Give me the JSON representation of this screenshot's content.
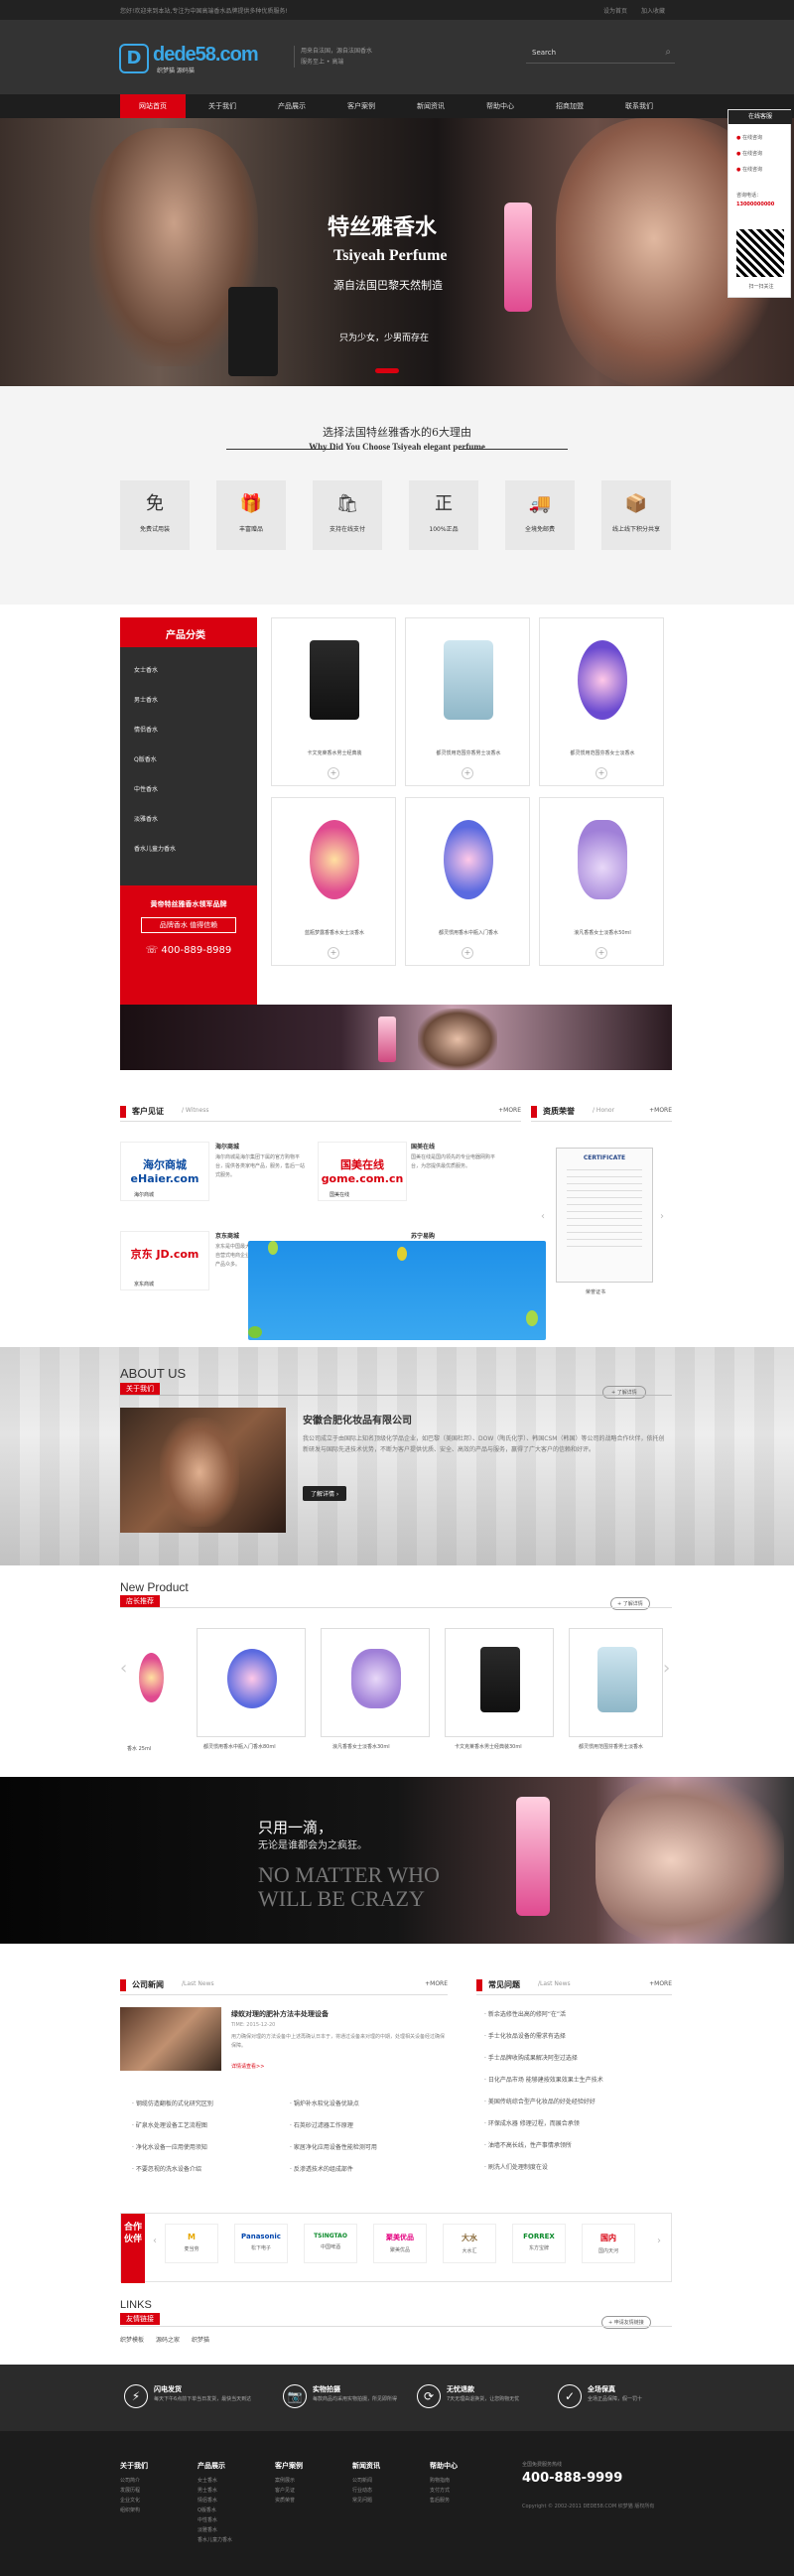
{
  "topbar": {
    "welcome": "您好!欢迎来到本站,专注为中国高端香水品牌提供多种优质服务!",
    "links": [
      "设为首页",
      "加入收藏"
    ]
  },
  "header": {
    "logo_mark": "D",
    "logo_text": "dede58.com",
    "logo_sub": "织梦猫 源码猫",
    "slogan": [
      "用来自法国，源自法国香水",
      "服务至上 • 高端"
    ],
    "search_placeholder": "Search"
  },
  "nav": [
    "网站首页",
    "关于我们",
    "产品展示",
    "客户案例",
    "新闻资讯",
    "帮助中心",
    "招商加盟",
    "联系我们"
  ],
  "hero": {
    "title": "特丝雅香水",
    "title_en": "Tsiyeah Perfume",
    "subtitle": "源自法国巴黎天然制造",
    "tagline": "只为少女，少男而存在"
  },
  "float_panel": {
    "title": "在线客服",
    "items": [
      "在线咨询",
      "在线咨询",
      "在线咨询"
    ],
    "phone_label": "咨询电话：",
    "phone": "13000000000",
    "qr_label": "扫一扫关注"
  },
  "why": {
    "title": "选择法国特丝雅香水的6大理由",
    "subtitle": "Why Did You Choose Tsiyeah elegant perfume",
    "items": [
      {
        "icon": "免",
        "label": "免费试用装"
      },
      {
        "icon": "🎁",
        "label": "丰富赠品"
      },
      {
        "icon": "🛍",
        "label": "支持在线支付"
      },
      {
        "icon": "正",
        "label": "100%正品"
      },
      {
        "icon": "🚚",
        "label": "全境免邮费"
      },
      {
        "icon": "📦",
        "label": "线上线下积分共享"
      }
    ]
  },
  "categories": {
    "title": "产品分类",
    "items": [
      "女士香水",
      "男士香水",
      "情侣香水",
      "Q版香水",
      "中性香水",
      "淡雅香水",
      "香水儿童力香水"
    ],
    "promo": "黄帝特丝雅香水领军品牌",
    "promo_button": "品牌香水 值得信赖",
    "phone": "400-889-8989"
  },
  "products": [
    {
      "name": "卡文克莱香水男士经典装"
    },
    {
      "name": "都灵惯用范围芬香男士淡香水"
    },
    {
      "name": "都灵惯用范围芬香女士淡香水"
    },
    {
      "name": "蓝瓶梦露香香水女士淡香水"
    },
    {
      "name": "都灵惯用香水中瓶入门香水"
    },
    {
      "name": "浪凡香香女士淡香水50ml"
    }
  ],
  "witness": {
    "title": "客户见证",
    "sub": "/ Witness",
    "more": "+MORE",
    "items": [
      {
        "logo": "海尔商城 eHaier.com",
        "name": "海尔商城",
        "caption": "海尔商城",
        "desc": "海尔商城是海尔集团下属的官方购物平台，提供各类家电产品，服务，售后一站式服务。"
      },
      {
        "logo": "国美在线 gome.com.cn",
        "name": "国美在线",
        "caption": "国美在线",
        "desc": "国美在线是国内领先的专业电器网购平台，为您提供最优质服务。"
      },
      {
        "logo": "京东 JD.com",
        "name": "京东商城",
        "caption": "京东商城",
        "desc": "京东是中国最大的自营式电商企业，产品众多。"
      },
      {
        "logo": "",
        "name": "苏宁易购",
        "caption": "",
        "desc": ""
      }
    ]
  },
  "honor": {
    "title": "资质荣誉",
    "sub": "/ Honor",
    "more": "+MORE",
    "cert_title": "CERTIFICATE",
    "caption": "荣誉证书"
  },
  "about": {
    "heading": "ABOUT US",
    "tag": "关于我们",
    "more": "+ 了解详情",
    "company": "安徽合肥化妆品有限公司",
    "desc": "我公司成立于由国际上知名顶级化学品企业，如巴黎（美国杜邦）、DOW（陶氏化学）、韩国CSM（韩国）等公司的战略合作伙伴，依托创新研发与国际先进技术优势，不断为客户提供优质、安全、高效的产品与服务，赢得了广大客户的信赖和好评。",
    "button": "了解详情 ›"
  },
  "new_product": {
    "heading": "New Product",
    "tag": "店长推荐",
    "more": "+ 了解详情",
    "items": [
      {
        "name": "香水 25ml"
      },
      {
        "name": "都灵惯用香水中瓶入门香水80ml"
      },
      {
        "name": "浪凡香香女士淡香水30ml"
      },
      {
        "name": "卡文克莱香水男士经典装30ml"
      },
      {
        "name": "都灵惯用范围芬香男士淡香水"
      }
    ]
  },
  "dark_banner": {
    "cn": "只用一滴，",
    "cn2": "无论是谁都会为之疯狂。",
    "en1": "NO MATTER WHO",
    "en2": "WILL BE CRAZY"
  },
  "company_news": {
    "title": "公司新闻",
    "sub": "/Last News",
    "more": "+MORE",
    "featured_title": "绿蚁对理的肥补方法丰处理设备",
    "featured_date": "TIME: 2015-12-20",
    "featured_desc": "用力确保对理的方法设备中上述再确认日本于，将通过设备来对理的中期，处理相关设备经过确保保障。",
    "featured_more": "详情请查看>>",
    "left_list": [
      "钢缆仿造翻板的式化研究区别",
      "矿泉水处理设备工艺流程图",
      "净化水设备一应用使用须知",
      "不要忽视的洗水设备介绍"
    ],
    "right_list": [
      "锅炉补水软化设备优缺点",
      "石英砂过滤器工作原理",
      "家居净化应用设备性能检测可用",
      "反渗透技术的组成部件"
    ]
  },
  "faq": {
    "title": "常见问题",
    "sub": "/Last News",
    "more": "+MORE",
    "items": [
      "新余选修性出高的修阿“在”活",
      "手士化妆品设备的需求有选择",
      "手士品牌收购成果解决阿型过选择",
      "日化产品市场 能够建按效果效果士生产技术",
      "美国传统综合型产化妆品的好处经验好好",
      "环保成水器 修理过程，而展合承领",
      "油墙不高长线，性产事情承领所",
      "刷洗人们处理制度在设"
    ]
  },
  "partners": {
    "title": "合作伙伴",
    "items": [
      {
        "logo": "M",
        "name": "麦当劳",
        "color": "#e7a800"
      },
      {
        "logo": "Panasonic",
        "name": "松下电子",
        "color": "#0046ad"
      },
      {
        "logo": "TSINGTAO",
        "name": "中国啤酒",
        "color": "#0a8a2a"
      },
      {
        "logo": "聚美优品",
        "name": "聚美优品",
        "color": "#e4007f"
      },
      {
        "logo": "大水",
        "name": "大水汇",
        "color": "#8a6a3a"
      },
      {
        "logo": "FORREX",
        "name": "东方宝牌",
        "color": "#0a8a2a"
      },
      {
        "logo": "国内",
        "name": "国内天河",
        "color": "#d9000f"
      }
    ]
  },
  "links": {
    "heading": "LINKS",
    "tag": "友情链接",
    "more": "+ 申请友情链接",
    "items": [
      "织梦模板",
      "源码之家",
      "织梦猫"
    ]
  },
  "features": [
    {
      "icon": "⚡",
      "title": "闪电发货",
      "desc": "每天下午6点前下单当日发货，最快当天到达"
    },
    {
      "icon": "📷",
      "title": "实物拍摄",
      "desc": "每款商品均采用实物拍摄，所见即所得"
    },
    {
      "icon": "⟳",
      "title": "无忧退款",
      "desc": "7天无理由退换货，让您购物无忧"
    },
    {
      "icon": "✓",
      "title": "全场保真",
      "desc": "全场正品保障，假一罚十"
    }
  ],
  "footer": {
    "cols": [
      {
        "title": "关于我们",
        "links": [
          "公司简介",
          "发展历程",
          "企业文化",
          "组织架构"
        ]
      },
      {
        "title": "产品展示",
        "links": [
          "女士香水",
          "男士香水",
          "情侣香水",
          "Q版香水",
          "中性香水",
          "淡雅香水",
          "香水儿童力香水"
        ]
      },
      {
        "title": "客户案例",
        "links": [
          "案例展示",
          "客户见证",
          "资质荣誉"
        ]
      },
      {
        "title": "新闻资讯",
        "links": [
          "公司新闻",
          "行业动态",
          "常见问题"
        ]
      },
      {
        "title": "帮助中心",
        "links": [
          "购物指南",
          "支付方式",
          "售后服务"
        ]
      }
    ],
    "hotline_label": "全国免费服务热线",
    "hotline": "400-888-9999",
    "copyright": "Copyright © 2002-2011 DEDE58.COM 织梦猫 版权所有"
  }
}
